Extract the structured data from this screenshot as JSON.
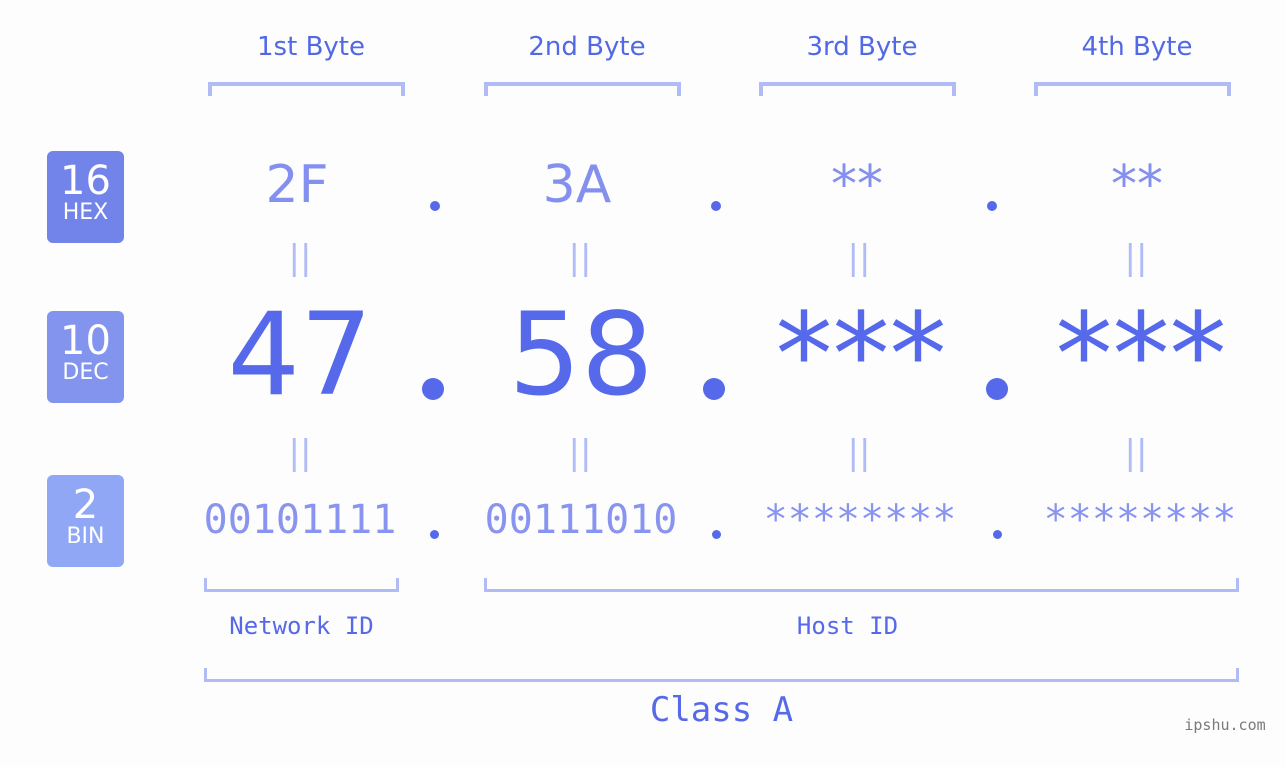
{
  "headers": [
    "1st Byte",
    "2nd Byte",
    "3rd Byte",
    "4th Byte"
  ],
  "badges": {
    "hex": {
      "num": "16",
      "label": "HEX",
      "color": "#7283ea"
    },
    "dec": {
      "num": "10",
      "label": "DEC",
      "color": "#8294ee"
    },
    "bin": {
      "num": "2",
      "label": "BIN",
      "color": "#8fa7f5"
    }
  },
  "hex": [
    "2F",
    "3A",
    "**",
    "**"
  ],
  "dec": [
    "47",
    "58",
    "***",
    "***"
  ],
  "bin": [
    "00101111",
    "00111010",
    "********",
    "********"
  ],
  "equals": "||",
  "network_label": "Network ID",
  "host_label": "Host ID",
  "class_label": "Class A",
  "watermark": "ipshu.com",
  "colors": {
    "accent": "#5669ea",
    "bracket": "#b1bbf5",
    "hex_text": "#8490ee",
    "bin_text": "#8894ef"
  }
}
